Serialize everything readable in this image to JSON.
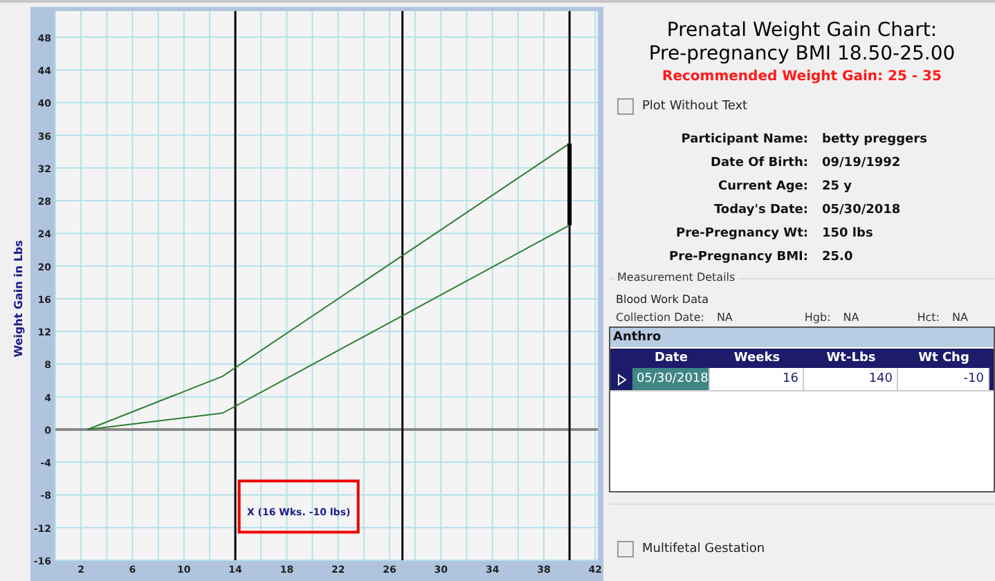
{
  "chart": {
    "chart_data": {
      "type": "line",
      "ylabel": "Weight Gain in Lbs",
      "xlim": [
        0,
        42.2
      ],
      "ylim": [
        -16,
        51.2
      ],
      "grid": true,
      "xticks": [
        2,
        6,
        10,
        14,
        18,
        22,
        26,
        30,
        34,
        38,
        42
      ],
      "yticks": [
        -16,
        -12,
        -8,
        -4,
        0,
        4,
        8,
        12,
        16,
        20,
        24,
        28,
        32,
        36,
        40,
        44,
        48
      ],
      "series": [
        {
          "color": "#2e7d32",
          "x": [
            2.5,
            13,
            40
          ],
          "values": [
            0,
            6.5,
            35
          ]
        },
        {
          "color": "#2e7d32",
          "x": [
            2.5,
            13,
            40
          ],
          "values": [
            0,
            2,
            25
          ]
        },
        {
          "color": "#000000",
          "x": [
            40,
            40
          ],
          "values": [
            25,
            35
          ]
        }
      ],
      "ref_lines": [
        {
          "axis": "x",
          "value": 14
        },
        {
          "axis": "x",
          "value": 27
        },
        {
          "axis": "x",
          "value": 40
        }
      ],
      "annotations": [
        "X (16 Wks. -10 lbs)"
      ]
    }
  },
  "title_lines": [
    "Prenatal Weight Gain Chart:",
    "Pre-pregnancy BMI 18.50-25.00"
  ],
  "recommended": "Recommended Weight Gain: 25 - 35",
  "plot_without_text": {
    "label": "Plot Without Text",
    "checked": false
  },
  "details": [
    {
      "label": "Participant Name:",
      "value": "betty preggers"
    },
    {
      "label": "Date Of Birth:",
      "value": "09/19/1992"
    },
    {
      "label": "Current Age:",
      "value": "25 y"
    },
    {
      "label": "Today's Date:",
      "value": "05/30/2018"
    },
    {
      "label": "Pre-Pregnancy Wt:",
      "value": "150 lbs"
    },
    {
      "label": "Pre-Pregnancy BMI:",
      "value": "25.0"
    }
  ],
  "measurement": {
    "title": "Measurement Details",
    "subtitle": "Blood Work Data",
    "fields": [
      {
        "label": "Collection Date:",
        "value": "NA"
      },
      {
        "label": "Hgb:",
        "value": "NA"
      },
      {
        "label": "Hct:",
        "value": "NA"
      }
    ]
  },
  "table": {
    "title": "Anthro",
    "columns": [
      "Date",
      "Weeks",
      "Wt-Lbs",
      "Wt Chg"
    ],
    "rows": [
      {
        "selected": true,
        "cells": [
          "05/30/2018",
          "16",
          "140",
          "-10"
        ]
      }
    ]
  },
  "multifetal": {
    "label": "Multifetal Gestation",
    "checked": false
  }
}
